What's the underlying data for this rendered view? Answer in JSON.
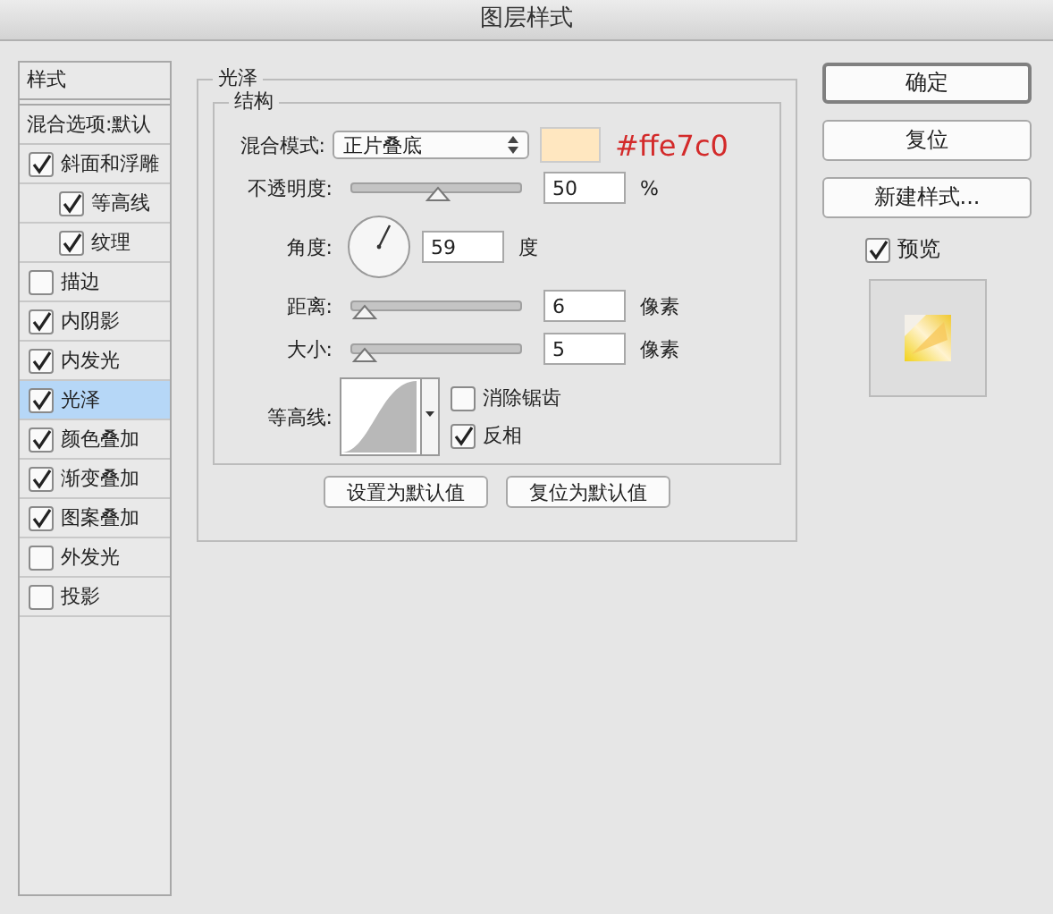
{
  "window": {
    "title": "图层样式"
  },
  "sidebar": {
    "header": "样式",
    "blend_options": "混合选项:默认",
    "items": [
      {
        "label": "斜面和浮雕",
        "checked": true,
        "selected": false,
        "children": [
          {
            "label": "等高线",
            "checked": true,
            "selected": false
          },
          {
            "label": "纹理",
            "checked": true,
            "selected": false
          }
        ]
      },
      {
        "label": "描边",
        "checked": false,
        "selected": false
      },
      {
        "label": "内阴影",
        "checked": true,
        "selected": false
      },
      {
        "label": "内发光",
        "checked": true,
        "selected": false
      },
      {
        "label": "光泽",
        "checked": true,
        "selected": true
      },
      {
        "label": "颜色叠加",
        "checked": true,
        "selected": false
      },
      {
        "label": "渐变叠加",
        "checked": true,
        "selected": false
      },
      {
        "label": "图案叠加",
        "checked": true,
        "selected": false
      },
      {
        "label": "外发光",
        "checked": false,
        "selected": false
      },
      {
        "label": "投影",
        "checked": false,
        "selected": false
      }
    ]
  },
  "panel": {
    "title": "光泽",
    "group": "结构",
    "blend_mode": {
      "label": "混合模式:",
      "value": "正片叠底",
      "color": "#ffe7c0",
      "annotation": "#ffe7c0"
    },
    "rows": [
      {
        "kind": "slider",
        "label": "不透明度:",
        "level": 0.5,
        "value": "50",
        "unit": "%"
      },
      {
        "kind": "angle",
        "label": "角度:",
        "value": "59",
        "unit": "度"
      },
      {
        "kind": "slider",
        "label": "距离:",
        "level": 0.0,
        "value": "6",
        "unit": "像素"
      },
      {
        "kind": "slider",
        "label": "大小:",
        "level": 0.0,
        "value": "5",
        "unit": "像素"
      }
    ],
    "contour": {
      "label": "等高线:",
      "options": [
        {
          "label": "消除锯齿",
          "checked": false
        },
        {
          "label": "反相",
          "checked": true
        }
      ]
    },
    "buttons": [
      "设置为默认值",
      "复位为默认值"
    ]
  },
  "actions": {
    "buttons": [
      {
        "label": "确定",
        "primary": true
      },
      {
        "label": "复位",
        "primary": false
      },
      {
        "label": "新建样式...",
        "primary": false
      }
    ],
    "preview": {
      "label": "预览",
      "checked": true
    }
  }
}
